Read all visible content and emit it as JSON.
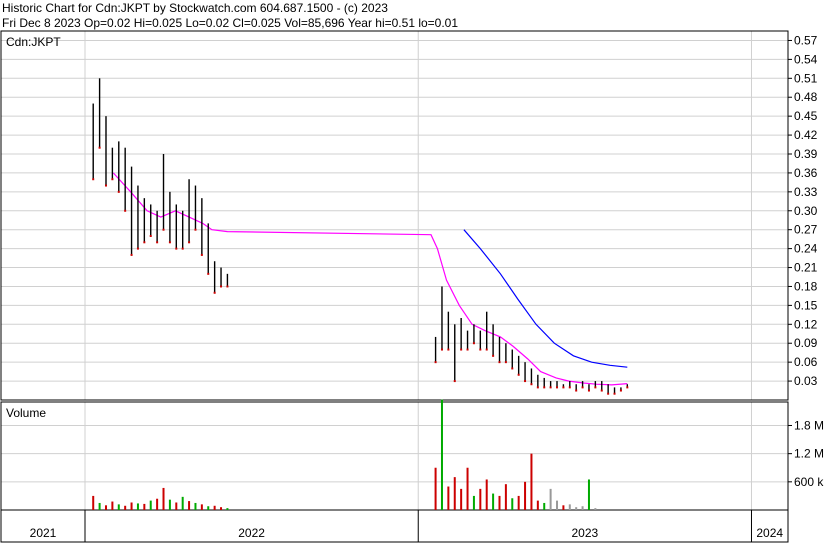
{
  "header": {
    "line1": "Historic Chart for Cdn:JKPT by Stockwatch.com 604.687.1500 - (c) 2023",
    "line2": "Fri Dec  8 2023  Op=0.02  Hi=0.025  Lo=0.02  Cl=0.025  Vol=85,696  Year hi=0.51  lo=0.01"
  },
  "chart_data": [
    {
      "type": "line",
      "title": "Cdn:JKPT",
      "price_ticks": [
        "0.57",
        "0.54",
        "0.51",
        "0.48",
        "0.45",
        "0.42",
        "0.39",
        "0.36",
        "0.33",
        "0.30",
        "0.27",
        "0.24",
        "0.21",
        "0.18",
        "0.15",
        "0.12",
        "0.09",
        "0.06",
        "0.03"
      ],
      "ylim": [
        0,
        0.585
      ],
      "x_range": [
        "2021-10-01",
        "2023-12-08"
      ],
      "grid": true,
      "colors": {
        "price": "#000000",
        "ma_short": "#ff00ff",
        "ma_long": "#0000ff",
        "down_close": "#cc0000"
      },
      "series": [
        {
          "key": "price_hi",
          "points": [
            [
              "2022-01-10",
              0.47
            ],
            [
              "2022-01-17",
              0.51
            ],
            [
              "2022-01-24",
              0.45
            ],
            [
              "2022-01-31",
              0.4
            ],
            [
              "2022-02-07",
              0.41
            ],
            [
              "2022-02-14",
              0.4
            ],
            [
              "2022-02-21",
              0.37
            ],
            [
              "2022-02-28",
              0.34
            ],
            [
              "2022-03-07",
              0.32
            ],
            [
              "2022-03-14",
              0.31
            ],
            [
              "2022-03-21",
              0.3
            ],
            [
              "2022-03-28",
              0.39
            ],
            [
              "2022-04-04",
              0.33
            ],
            [
              "2022-04-11",
              0.31
            ],
            [
              "2022-04-18",
              0.3
            ],
            [
              "2022-04-25",
              0.35
            ],
            [
              "2022-05-02",
              0.34
            ],
            [
              "2022-05-09",
              0.32
            ],
            [
              "2022-05-16",
              0.28
            ],
            [
              "2022-05-23",
              0.22
            ],
            [
              "2022-05-30",
              0.21
            ],
            [
              "2022-06-06",
              0.2
            ],
            [
              "2023-01-20",
              0.1
            ],
            [
              "2023-01-27",
              0.18
            ],
            [
              "2023-02-03",
              0.14
            ],
            [
              "2023-02-10",
              0.12
            ],
            [
              "2023-02-17",
              0.13
            ],
            [
              "2023-02-24",
              0.11
            ],
            [
              "2023-03-03",
              0.12
            ],
            [
              "2023-03-10",
              0.11
            ],
            [
              "2023-03-17",
              0.14
            ],
            [
              "2023-03-24",
              0.12
            ],
            [
              "2023-03-31",
              0.1
            ],
            [
              "2023-04-07",
              0.09
            ],
            [
              "2023-04-14",
              0.08
            ],
            [
              "2023-04-21",
              0.07
            ],
            [
              "2023-04-28",
              0.06
            ],
            [
              "2023-05-05",
              0.05
            ],
            [
              "2023-05-12",
              0.04
            ],
            [
              "2023-05-19",
              0.035
            ],
            [
              "2023-05-26",
              0.03
            ],
            [
              "2023-06-02",
              0.03
            ],
            [
              "2023-06-09",
              0.025
            ],
            [
              "2023-06-16",
              0.03
            ],
            [
              "2023-06-23",
              0.025
            ],
            [
              "2023-06-30",
              0.03
            ],
            [
              "2023-07-07",
              0.025
            ],
            [
              "2023-07-14",
              0.03
            ],
            [
              "2023-07-21",
              0.03
            ],
            [
              "2023-07-28",
              0.025
            ],
            [
              "2023-08-04",
              0.02
            ],
            [
              "2023-08-11",
              0.02
            ],
            [
              "2023-08-18",
              0.025
            ]
          ]
        },
        {
          "key": "price_lo",
          "points": [
            [
              "2022-01-10",
              0.35
            ],
            [
              "2022-01-17",
              0.4
            ],
            [
              "2022-01-24",
              0.34
            ],
            [
              "2022-01-31",
              0.35
            ],
            [
              "2022-02-07",
              0.33
            ],
            [
              "2022-02-14",
              0.3
            ],
            [
              "2022-02-21",
              0.23
            ],
            [
              "2022-02-28",
              0.24
            ],
            [
              "2022-03-07",
              0.25
            ],
            [
              "2022-03-14",
              0.26
            ],
            [
              "2022-03-21",
              0.25
            ],
            [
              "2022-03-28",
              0.27
            ],
            [
              "2022-04-04",
              0.25
            ],
            [
              "2022-04-11",
              0.24
            ],
            [
              "2022-04-18",
              0.24
            ],
            [
              "2022-04-25",
              0.25
            ],
            [
              "2022-05-02",
              0.27
            ],
            [
              "2022-05-09",
              0.23
            ],
            [
              "2022-05-16",
              0.2
            ],
            [
              "2022-05-23",
              0.17
            ],
            [
              "2022-05-30",
              0.18
            ],
            [
              "2022-06-06",
              0.18
            ],
            [
              "2023-01-20",
              0.06
            ],
            [
              "2023-01-27",
              0.08
            ],
            [
              "2023-02-03",
              0.08
            ],
            [
              "2023-02-10",
              0.03
            ],
            [
              "2023-02-17",
              0.08
            ],
            [
              "2023-02-24",
              0.08
            ],
            [
              "2023-03-03",
              0.09
            ],
            [
              "2023-03-10",
              0.08
            ],
            [
              "2023-03-17",
              0.08
            ],
            [
              "2023-03-24",
              0.07
            ],
            [
              "2023-03-31",
              0.06
            ],
            [
              "2023-04-07",
              0.06
            ],
            [
              "2023-04-14",
              0.05
            ],
            [
              "2023-04-21",
              0.04
            ],
            [
              "2023-04-28",
              0.03
            ],
            [
              "2023-05-05",
              0.025
            ],
            [
              "2023-05-12",
              0.02
            ],
            [
              "2023-05-19",
              0.02
            ],
            [
              "2023-05-26",
              0.02
            ],
            [
              "2023-06-02",
              0.02
            ],
            [
              "2023-06-09",
              0.02
            ],
            [
              "2023-06-16",
              0.02
            ],
            [
              "2023-06-23",
              0.015
            ],
            [
              "2023-06-30",
              0.02
            ],
            [
              "2023-07-07",
              0.015
            ],
            [
              "2023-07-14",
              0.02
            ],
            [
              "2023-07-21",
              0.015
            ],
            [
              "2023-07-28",
              0.01
            ],
            [
              "2023-08-04",
              0.01
            ],
            [
              "2023-08-11",
              0.015
            ],
            [
              "2023-08-18",
              0.02
            ]
          ]
        },
        {
          "key": "ma_short",
          "points": [
            [
              "2022-02-01",
              0.36
            ],
            [
              "2022-02-20",
              0.33
            ],
            [
              "2022-03-10",
              0.3
            ],
            [
              "2022-03-25",
              0.29
            ],
            [
              "2022-04-10",
              0.3
            ],
            [
              "2022-04-25",
              0.29
            ],
            [
              "2022-05-10",
              0.28
            ],
            [
              "2022-05-20",
              0.27
            ],
            [
              "2022-06-06",
              0.267
            ],
            [
              "2023-01-15",
              0.262
            ],
            [
              "2023-01-22",
              0.24
            ],
            [
              "2023-02-01",
              0.19
            ],
            [
              "2023-02-15",
              0.15
            ],
            [
              "2023-03-01",
              0.12
            ],
            [
              "2023-03-15",
              0.11
            ],
            [
              "2023-04-01",
              0.1
            ],
            [
              "2023-04-15",
              0.085
            ],
            [
              "2023-05-01",
              0.065
            ],
            [
              "2023-05-15",
              0.045
            ],
            [
              "2023-06-01",
              0.035
            ],
            [
              "2023-06-15",
              0.03
            ],
            [
              "2023-07-01",
              0.027
            ],
            [
              "2023-07-15",
              0.025
            ],
            [
              "2023-08-01",
              0.024
            ],
            [
              "2023-08-18",
              0.026
            ]
          ]
        },
        {
          "key": "ma_long",
          "points": [
            [
              "2023-02-20",
              0.27
            ],
            [
              "2023-03-10",
              0.24
            ],
            [
              "2023-04-01",
              0.2
            ],
            [
              "2023-04-20",
              0.16
            ],
            [
              "2023-05-10",
              0.12
            ],
            [
              "2023-05-30",
              0.09
            ],
            [
              "2023-06-20",
              0.07
            ],
            [
              "2023-07-10",
              0.06
            ],
            [
              "2023-07-30",
              0.055
            ],
            [
              "2023-08-18",
              0.052
            ]
          ]
        }
      ]
    },
    {
      "type": "bar",
      "title": "Volume",
      "volume_ticks": [
        "1.8 M",
        "1.2 M",
        "600 k"
      ],
      "ylim": [
        0,
        2300000
      ],
      "colors": {
        "up": "#00aa00",
        "down": "#cc0000",
        "flat": "#999999"
      },
      "bars": [
        [
          "2022-01-10",
          300000,
          "down"
        ],
        [
          "2022-01-17",
          150000,
          "up"
        ],
        [
          "2022-01-24",
          100000,
          "down"
        ],
        [
          "2022-01-31",
          180000,
          "down"
        ],
        [
          "2022-02-07",
          120000,
          "up"
        ],
        [
          "2022-02-14",
          90000,
          "down"
        ],
        [
          "2022-02-21",
          160000,
          "down"
        ],
        [
          "2022-02-28",
          140000,
          "up"
        ],
        [
          "2022-03-07",
          130000,
          "down"
        ],
        [
          "2022-03-14",
          200000,
          "up"
        ],
        [
          "2022-03-21",
          240000,
          "down"
        ],
        [
          "2022-03-28",
          470000,
          "down"
        ],
        [
          "2022-04-04",
          220000,
          "up"
        ],
        [
          "2022-04-11",
          160000,
          "down"
        ],
        [
          "2022-04-18",
          280000,
          "up"
        ],
        [
          "2022-04-25",
          190000,
          "down"
        ],
        [
          "2022-05-02",
          150000,
          "up"
        ],
        [
          "2022-05-09",
          120000,
          "down"
        ],
        [
          "2022-05-16",
          80000,
          "up"
        ],
        [
          "2022-05-23",
          90000,
          "down"
        ],
        [
          "2022-05-30",
          60000,
          "down"
        ],
        [
          "2022-06-06",
          40000,
          "up"
        ],
        [
          "2023-01-20",
          900000,
          "down"
        ],
        [
          "2023-01-27",
          2350000,
          "up"
        ],
        [
          "2023-02-03",
          500000,
          "down"
        ],
        [
          "2023-02-10",
          700000,
          "down"
        ],
        [
          "2023-02-17",
          450000,
          "down"
        ],
        [
          "2023-02-24",
          900000,
          "down"
        ],
        [
          "2023-03-03",
          300000,
          "up"
        ],
        [
          "2023-03-10",
          450000,
          "down"
        ],
        [
          "2023-03-17",
          650000,
          "down"
        ],
        [
          "2023-03-24",
          350000,
          "up"
        ],
        [
          "2023-03-31",
          300000,
          "down"
        ],
        [
          "2023-04-07",
          550000,
          "down"
        ],
        [
          "2023-04-14",
          250000,
          "up"
        ],
        [
          "2023-04-21",
          300000,
          "down"
        ],
        [
          "2023-04-28",
          600000,
          "down"
        ],
        [
          "2023-05-05",
          1200000,
          "down"
        ],
        [
          "2023-05-12",
          200000,
          "down"
        ],
        [
          "2023-05-19",
          150000,
          "up"
        ],
        [
          "2023-05-26",
          450000,
          "flat"
        ],
        [
          "2023-06-02",
          200000,
          "flat"
        ],
        [
          "2023-06-09",
          100000,
          "down"
        ],
        [
          "2023-06-16",
          120000,
          "flat"
        ],
        [
          "2023-06-23",
          60000,
          "flat"
        ],
        [
          "2023-06-30",
          80000,
          "flat"
        ],
        [
          "2023-07-07",
          650000,
          "up"
        ],
        [
          "2023-07-14",
          40000,
          "flat"
        ]
      ]
    }
  ],
  "x_axis": {
    "labels": [
      {
        "text": "2021",
        "date": "2022-01-01",
        "span_start": "2021-10-01",
        "span_end": "2022-01-01"
      },
      {
        "text": "2022",
        "date": "2022-07-02",
        "span_start": "2022-01-01",
        "span_end": "2023-01-01"
      },
      {
        "text": "2023",
        "date": "2023-07-02",
        "span_start": "2023-01-01",
        "span_end": "2024-01-01"
      },
      {
        "text": "2024",
        "date": "2024-01-10",
        "span_start": "2024-01-01",
        "span_end": "2024-02-10"
      }
    ],
    "year_breaks": [
      "2022-01-01",
      "2023-01-01",
      "2024-01-01"
    ]
  }
}
